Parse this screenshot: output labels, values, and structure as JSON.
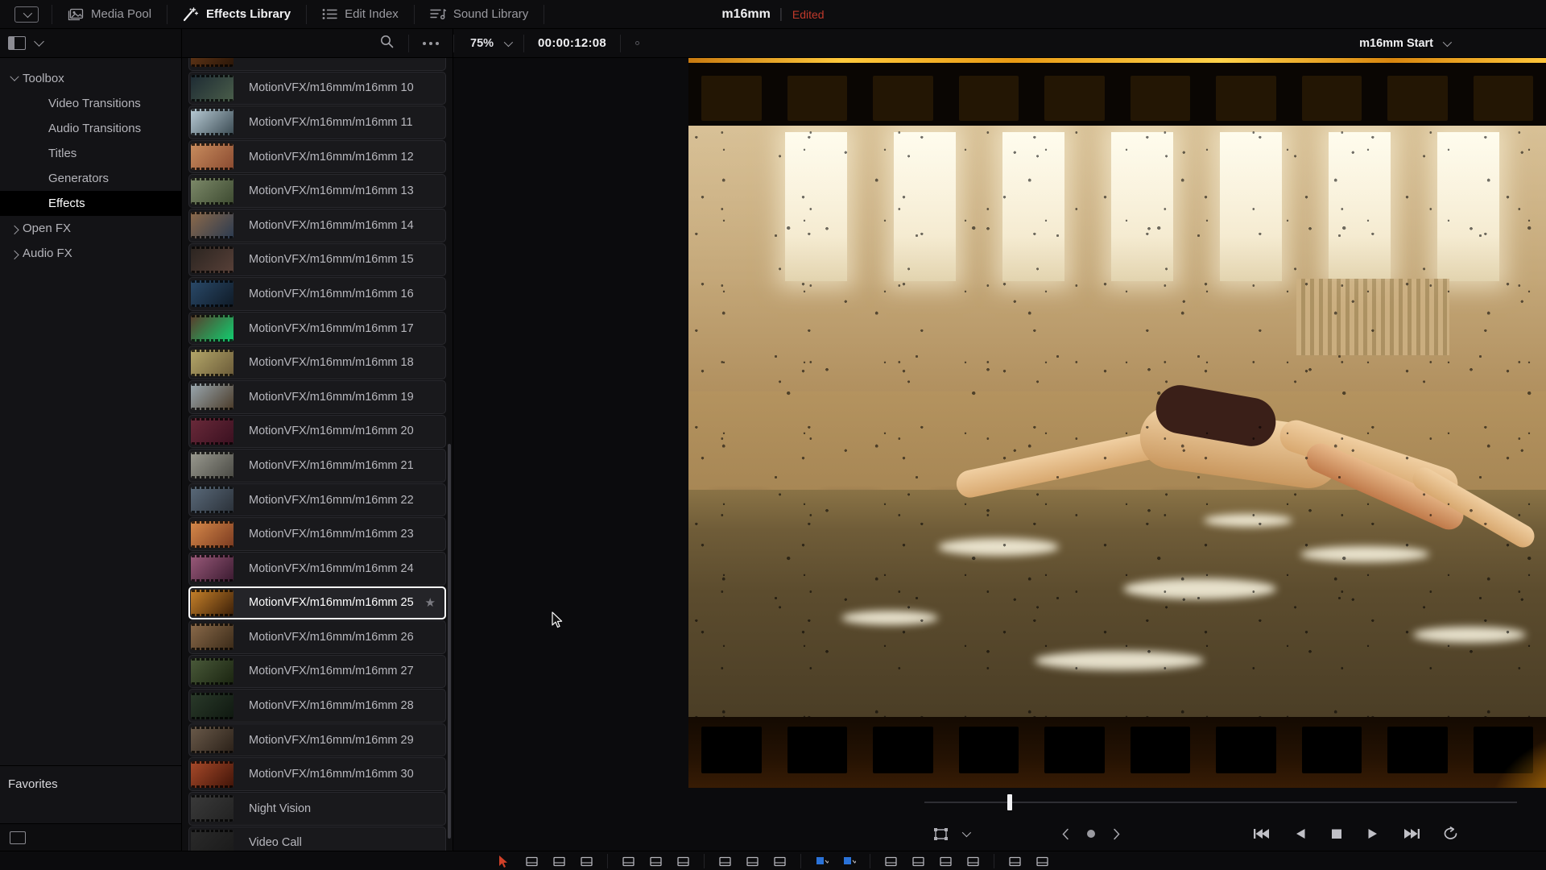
{
  "topbar": {
    "toggle_icon": "panel-toggle-icon",
    "tabs": [
      {
        "label": "Media Pool",
        "icon": "media-pool-icon",
        "active": false
      },
      {
        "label": "Effects Library",
        "icon": "magic-wand-icon",
        "active": true
      },
      {
        "label": "Edit Index",
        "icon": "list-icon",
        "active": false
      },
      {
        "label": "Sound Library",
        "icon": "sound-library-icon",
        "active": false
      }
    ],
    "project_title": "m16mm",
    "project_status": "Edited",
    "status_color": "#c0392b"
  },
  "library": {
    "header": {
      "layout_icon": "sidebar-layout-icon",
      "chevron_icon": "chevron-down-icon"
    },
    "tree": [
      {
        "label": "Toolbox",
        "level": 0,
        "expanded": true,
        "selected": false
      },
      {
        "label": "Video Transitions",
        "level": 1,
        "expanded": null,
        "selected": false
      },
      {
        "label": "Audio Transitions",
        "level": 1,
        "expanded": null,
        "selected": false
      },
      {
        "label": "Titles",
        "level": 1,
        "expanded": null,
        "selected": false
      },
      {
        "label": "Generators",
        "level": 1,
        "expanded": null,
        "selected": false
      },
      {
        "label": "Effects",
        "level": 1,
        "expanded": null,
        "selected": true
      },
      {
        "label": "Open FX",
        "level": 0,
        "expanded": false,
        "selected": false
      },
      {
        "label": "Audio FX",
        "level": 0,
        "expanded": false,
        "selected": false
      }
    ],
    "favorites_label": "Favorites"
  },
  "effects_list": {
    "search_icon": "search-icon",
    "options_icon": "more-options-icon",
    "items": [
      {
        "name": "",
        "thumb": [
          "#6b3c1a",
          "#2a1608"
        ],
        "partial": true,
        "selected": false,
        "fav": false
      },
      {
        "name": "MotionVFX/m16mm/m16mm 10",
        "thumb": [
          "#1d2a33",
          "#4a5e4a"
        ],
        "selected": false,
        "fav": false
      },
      {
        "name": "MotionVFX/m16mm/m16mm 11",
        "thumb": [
          "#b9ccd6",
          "#3a4a52"
        ],
        "selected": false,
        "fav": false
      },
      {
        "name": "MotionVFX/m16mm/m16mm 12",
        "thumb": [
          "#c98d5e",
          "#8a4a30"
        ],
        "selected": false,
        "fav": false
      },
      {
        "name": "MotionVFX/m16mm/m16mm 13",
        "thumb": [
          "#7d8a6a",
          "#3d4a30"
        ],
        "selected": false,
        "fav": false
      },
      {
        "name": "MotionVFX/m16mm/m16mm 14",
        "thumb": [
          "#8d6a4a",
          "#2a3a50"
        ],
        "selected": false,
        "fav": false
      },
      {
        "name": "MotionVFX/m16mm/m16mm 15",
        "thumb": [
          "#2a2420",
          "#584038"
        ],
        "selected": false,
        "fav": false
      },
      {
        "name": "MotionVFX/m16mm/m16mm 16",
        "thumb": [
          "#2a4a6a",
          "#0f1a26"
        ],
        "selected": false,
        "fav": false
      },
      {
        "name": "MotionVFX/m16mm/m16mm 17",
        "thumb": [
          "#5a3a2a",
          "#10d070"
        ],
        "selected": false,
        "fav": false
      },
      {
        "name": "MotionVFX/m16mm/m16mm 18",
        "thumb": [
          "#b5a86a",
          "#6a5a38"
        ],
        "selected": false,
        "fav": false
      },
      {
        "name": "MotionVFX/m16mm/m16mm 19",
        "thumb": [
          "#9aa8b0",
          "#4a3a28"
        ],
        "selected": false,
        "fav": false
      },
      {
        "name": "MotionVFX/m16mm/m16mm 20",
        "thumb": [
          "#6a2a3a",
          "#3a1020"
        ],
        "selected": false,
        "fav": false
      },
      {
        "name": "MotionVFX/m16mm/m16mm 21",
        "thumb": [
          "#9a9a90",
          "#4a4a44"
        ],
        "selected": false,
        "fav": false
      },
      {
        "name": "MotionVFX/m16mm/m16mm 22",
        "thumb": [
          "#5a6a7a",
          "#2a3038"
        ],
        "selected": false,
        "fav": false
      },
      {
        "name": "MotionVFX/m16mm/m16mm 23",
        "thumb": [
          "#d88a4a",
          "#7a3a20"
        ],
        "selected": false,
        "fav": false
      },
      {
        "name": "MotionVFX/m16mm/m16mm 24",
        "thumb": [
          "#9a5a7a",
          "#3a1a30"
        ],
        "selected": false,
        "fav": false
      },
      {
        "name": "MotionVFX/m16mm/m16mm 25",
        "thumb": [
          "#c8822a",
          "#3a1e08"
        ],
        "selected": true,
        "fav": true
      },
      {
        "name": "MotionVFX/m16mm/m16mm 26",
        "thumb": [
          "#8a6a4a",
          "#3a2a18"
        ],
        "selected": false,
        "fav": false
      },
      {
        "name": "MotionVFX/m16mm/m16mm 27",
        "thumb": [
          "#4a5a3a",
          "#1a2410"
        ],
        "selected": false,
        "fav": false
      },
      {
        "name": "MotionVFX/m16mm/m16mm 28",
        "thumb": [
          "#2a3a2a",
          "#0f1810"
        ],
        "selected": false,
        "fav": false
      },
      {
        "name": "MotionVFX/m16mm/m16mm 29",
        "thumb": [
          "#6a5a4a",
          "#2a2018"
        ],
        "selected": false,
        "fav": false
      },
      {
        "name": "MotionVFX/m16mm/m16mm 30",
        "thumb": [
          "#a84a2a",
          "#401408"
        ],
        "selected": false,
        "fav": false
      },
      {
        "name": "Night Vision",
        "thumb": [
          "#3a3a3a",
          "#222222"
        ],
        "selected": false,
        "fav": false
      },
      {
        "name": "Video Call",
        "thumb": [
          "#2a2a2a",
          "#1a1a1a"
        ],
        "selected": false,
        "fav": false
      }
    ],
    "selected_star_icon": "star-icon",
    "cursor_icon": "mouse-cursor"
  },
  "viewer": {
    "zoom_level": "75%",
    "zoom_chevron_icon": "chevron-down-icon",
    "timecode": "00:00:12:08",
    "marker_icon": "marker-dot-icon",
    "source_label": "m16mm Start",
    "source_chevron_icon": "chevron-down-icon",
    "playhead_percent": 14,
    "bottom_left": {
      "transform_icon": "transform-tool-icon",
      "transform_chevron_icon": "chevron-down-icon",
      "prev_icon": "chevron-left-icon",
      "node_icon": "node-dot-icon",
      "next_icon": "chevron-right-icon"
    },
    "transport": [
      {
        "icon": "jump-to-start-icon",
        "label": "Jump to First Frame"
      },
      {
        "icon": "play-reverse-icon",
        "label": "Play Reverse"
      },
      {
        "icon": "stop-icon",
        "label": "Stop"
      },
      {
        "icon": "play-forward-icon",
        "label": "Play Forward"
      },
      {
        "icon": "jump-to-end-icon",
        "label": "Jump to Last Frame"
      },
      {
        "icon": "loop-icon",
        "label": "Loop"
      }
    ]
  },
  "pagebar": {
    "groups": [
      [
        "cursor-arrow-icon",
        "media-page-icon",
        "cut-page-icon",
        "edit-page-icon"
      ],
      [
        "fusion-page-icon",
        "color-page-icon",
        "fairlight-page-icon"
      ],
      [
        "trim-edit-icon",
        "dynamic-trim-icon",
        "razor-icon"
      ],
      [
        "blue-marker-icon",
        "blue-flag-icon"
      ],
      [
        "snap-icon",
        "link-icon",
        "position-lock-icon",
        "flag-icon"
      ],
      [
        "audio-icon",
        "export-icon"
      ]
    ]
  }
}
